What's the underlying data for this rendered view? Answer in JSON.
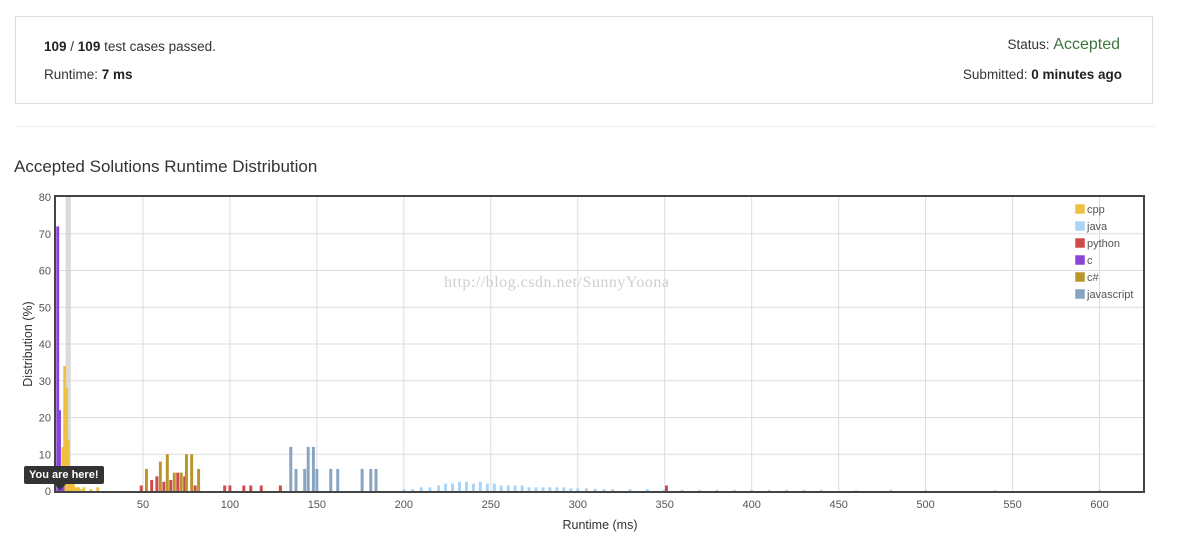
{
  "summary": {
    "passed_count": "109",
    "separator": " / ",
    "total_count": "109",
    "passed_suffix": " test cases passed.",
    "runtime_label": "Runtime: ",
    "runtime_value": "7 ms",
    "status_label": "Status: ",
    "status_value": "Accepted",
    "submitted_label": "Submitted: ",
    "submitted_value": "0 minutes ago"
  },
  "watermark": "http://blog.csdn.net/SunnyYoona",
  "marker_label": "You are here!",
  "colors": {
    "cpp": "#f0c040",
    "java": "#aad4f5",
    "python": "#d04a4a",
    "c": "#8a44d8",
    "c#": "#b8962c",
    "javascript": "#87a4c2",
    "marker": "#cccccc"
  },
  "chart_data": {
    "type": "bar",
    "title": "Accepted Solutions Runtime Distribution",
    "xlabel": "Runtime (ms)",
    "ylabel": "Distribution (%)",
    "xlim": [
      0,
      625
    ],
    "ylim": [
      0,
      80
    ],
    "xticks": [
      50,
      100,
      150,
      200,
      250,
      300,
      350,
      400,
      450,
      500,
      550,
      600
    ],
    "yticks": [
      0,
      10,
      20,
      30,
      40,
      50,
      60,
      70,
      80
    ],
    "legend_position": "top-right",
    "grid": true,
    "your_runtime": 7,
    "series": [
      {
        "name": "cpp",
        "points": [
          [
            2,
            3
          ],
          [
            4,
            12
          ],
          [
            5,
            34
          ],
          [
            6,
            28
          ],
          [
            7,
            14
          ],
          [
            8,
            5
          ],
          [
            9,
            3
          ],
          [
            10,
            2
          ],
          [
            11,
            1
          ],
          [
            12,
            1
          ],
          [
            13,
            1
          ],
          [
            14,
            0.5
          ],
          [
            16,
            1
          ],
          [
            20,
            0.5
          ],
          [
            24,
            1
          ]
        ]
      },
      {
        "name": "java",
        "points": [
          [
            200,
            0.5
          ],
          [
            205,
            0.5
          ],
          [
            210,
            1
          ],
          [
            215,
            1
          ],
          [
            220,
            1.5
          ],
          [
            224,
            2
          ],
          [
            228,
            2
          ],
          [
            232,
            2.5
          ],
          [
            236,
            2.5
          ],
          [
            240,
            2
          ],
          [
            244,
            2.5
          ],
          [
            248,
            2
          ],
          [
            252,
            2
          ],
          [
            256,
            1.5
          ],
          [
            260,
            1.5
          ],
          [
            264,
            1.5
          ],
          [
            268,
            1.5
          ],
          [
            272,
            1
          ],
          [
            276,
            1
          ],
          [
            280,
            1
          ],
          [
            284,
            1
          ],
          [
            288,
            1
          ],
          [
            292,
            1
          ],
          [
            296,
            0.7
          ],
          [
            300,
            0.7
          ],
          [
            305,
            0.7
          ],
          [
            310,
            0.6
          ],
          [
            315,
            0.5
          ],
          [
            320,
            0.5
          ],
          [
            330,
            0.5
          ],
          [
            340,
            0.5
          ],
          [
            350,
            0.5
          ],
          [
            360,
            0.3
          ],
          [
            370,
            0.3
          ],
          [
            380,
            0.3
          ],
          [
            390,
            0.3
          ],
          [
            400,
            0.3
          ],
          [
            410,
            0.3
          ],
          [
            420,
            0.3
          ],
          [
            430,
            0.3
          ],
          [
            440,
            0.3
          ],
          [
            460,
            0.2
          ],
          [
            480,
            0.3
          ],
          [
            500,
            0.2
          ],
          [
            540,
            0.2
          ],
          [
            600,
            0.3
          ]
        ]
      },
      {
        "name": "python",
        "points": [
          [
            49,
            1.5
          ],
          [
            55,
            3
          ],
          [
            58,
            4
          ],
          [
            62,
            2.5
          ],
          [
            66,
            3
          ],
          [
            70,
            5
          ],
          [
            74,
            4
          ],
          [
            80,
            1.5
          ],
          [
            97,
            1.5
          ],
          [
            100,
            1.5
          ],
          [
            108,
            1.5
          ],
          [
            112,
            1.5
          ],
          [
            118,
            1.5
          ],
          [
            129,
            1.5
          ],
          [
            351,
            1.5
          ]
        ]
      },
      {
        "name": "c",
        "points": [
          [
            1,
            72
          ],
          [
            2,
            22
          ],
          [
            3,
            5
          ],
          [
            4,
            2
          ]
        ]
      },
      {
        "name": "c#",
        "points": [
          [
            52,
            6
          ],
          [
            60,
            8
          ],
          [
            64,
            10
          ],
          [
            68,
            5
          ],
          [
            72,
            5
          ],
          [
            75,
            10
          ],
          [
            78,
            10
          ],
          [
            82,
            6
          ]
        ]
      },
      {
        "name": "javascript",
        "points": [
          [
            135,
            12
          ],
          [
            138,
            6
          ],
          [
            143,
            6
          ],
          [
            145,
            12
          ],
          [
            148,
            12
          ],
          [
            150,
            6
          ],
          [
            158,
            6
          ],
          [
            162,
            6
          ],
          [
            176,
            6
          ],
          [
            181,
            6
          ],
          [
            184,
            6
          ]
        ]
      }
    ]
  }
}
